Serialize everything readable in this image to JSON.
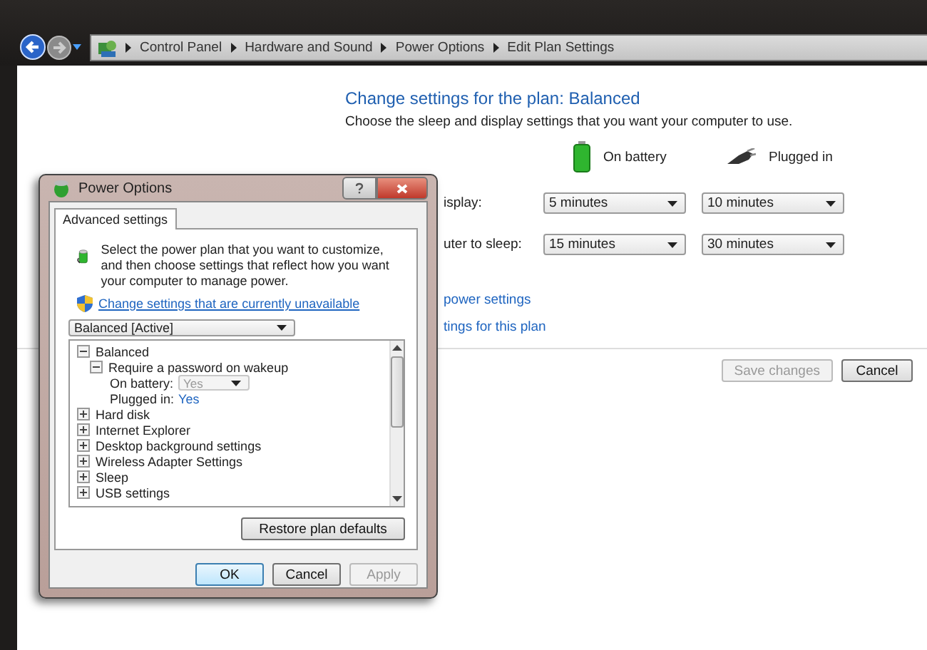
{
  "explorer": {
    "breadcrumbs": [
      "Control Panel",
      "Hardware and Sound",
      "Power Options",
      "Edit Plan Settings"
    ]
  },
  "plan": {
    "title": "Change settings for the plan: Balanced",
    "subtitle": "Choose the sleep and display settings that you want your computer to use.",
    "columns": [
      {
        "kind": "battery",
        "label": "On battery"
      },
      {
        "kind": "plug",
        "label": "Plugged in"
      }
    ],
    "settings": [
      {
        "label": "isplay:",
        "values": [
          "5 minutes",
          "10 minutes"
        ]
      },
      {
        "label": "uter to sleep:",
        "values": [
          "15 minutes",
          "30 minutes"
        ]
      }
    ],
    "links": [
      "power settings",
      "tings for this plan"
    ],
    "buttons": [
      {
        "label": "Save changes",
        "disabled": true
      },
      {
        "label": "Cancel",
        "disabled": false
      }
    ]
  },
  "dialog": {
    "title": "Power Options",
    "tabs": [
      {
        "label": "Advanced settings",
        "selected": true
      }
    ],
    "intro": "Select the power plan that you want to customize, and then choose settings that reflect how you want your computer to manage power.",
    "link": "Change settings that are currently unavailable",
    "plan_select": "Balanced [Active]",
    "tree": [
      {
        "label": "Balanced",
        "expanded": true,
        "children": [
          {
            "label": "Require a password on wakeup",
            "expanded": true,
            "children": [
              {
                "kind": "dropdown",
                "label": "On battery:",
                "value": "Yes",
                "disabled": true
              },
              {
                "kind": "link",
                "label": "Plugged in:",
                "value": "Yes"
              }
            ]
          }
        ]
      },
      {
        "label": "Hard disk",
        "expanded": false
      },
      {
        "label": "Internet Explorer",
        "expanded": false
      },
      {
        "label": "Desktop background settings",
        "expanded": false
      },
      {
        "label": "Wireless Adapter Settings",
        "expanded": false
      },
      {
        "label": "Sleep",
        "expanded": false
      },
      {
        "label": "USB settings",
        "expanded": false
      }
    ],
    "restore_button": "Restore plan defaults",
    "buttons": [
      {
        "label": "OK",
        "default": true,
        "disabled": false
      },
      {
        "label": "Cancel",
        "default": false,
        "disabled": false
      },
      {
        "label": "Apply",
        "default": false,
        "disabled": true
      }
    ]
  }
}
